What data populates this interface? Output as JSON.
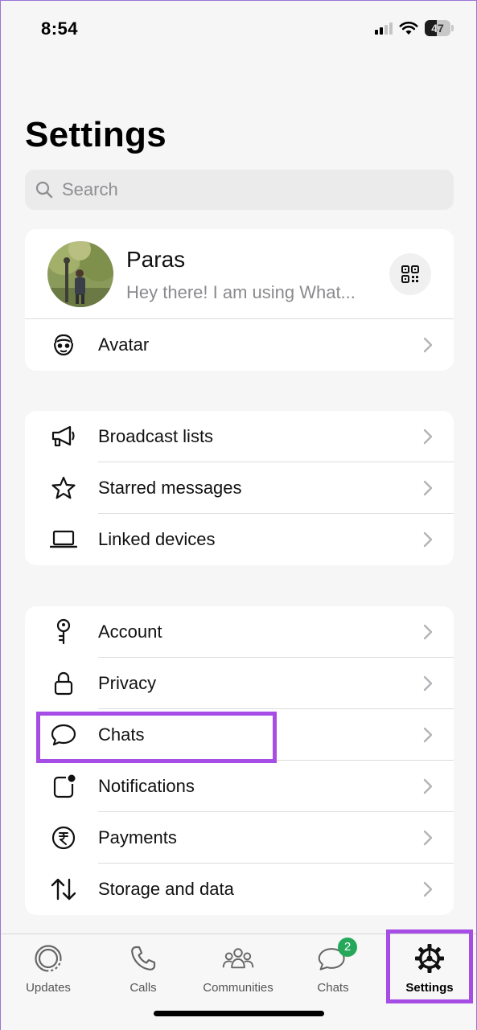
{
  "status_bar": {
    "time": "8:54",
    "battery": "47"
  },
  "header": {
    "title": "Settings"
  },
  "search": {
    "placeholder": "Search"
  },
  "profile": {
    "name": "Paras",
    "status": "Hey there! I am using What..."
  },
  "group1": [
    {
      "label": "Avatar",
      "icon": "avatar-face-icon"
    }
  ],
  "group2": [
    {
      "label": "Broadcast lists",
      "icon": "megaphone-icon"
    },
    {
      "label": "Starred messages",
      "icon": "star-icon"
    },
    {
      "label": "Linked devices",
      "icon": "laptop-icon"
    }
  ],
  "group3": [
    {
      "label": "Account",
      "icon": "key-icon"
    },
    {
      "label": "Privacy",
      "icon": "lock-icon"
    },
    {
      "label": "Chats",
      "icon": "chat-bubble-icon"
    },
    {
      "label": "Notifications",
      "icon": "notification-icon"
    },
    {
      "label": "Payments",
      "icon": "rupee-icon"
    },
    {
      "label": "Storage and data",
      "icon": "transfer-arrows-icon"
    }
  ],
  "tabs": [
    {
      "label": "Updates",
      "icon": "updates-icon"
    },
    {
      "label": "Calls",
      "icon": "phone-icon"
    },
    {
      "label": "Communities",
      "icon": "communities-icon"
    },
    {
      "label": "Chats",
      "icon": "chats-icon",
      "badge": "2"
    },
    {
      "label": "Settings",
      "icon": "gear-icon",
      "active": true
    }
  ],
  "colors": {
    "highlight": "#a64de6",
    "badge": "#25a85a"
  }
}
